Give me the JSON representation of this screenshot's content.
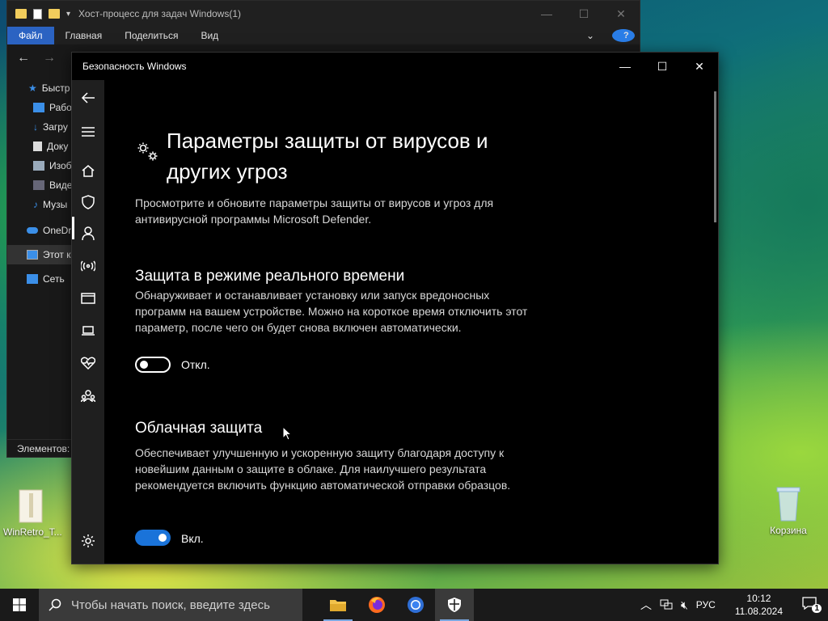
{
  "explorer": {
    "title": "Хост-процесс для задач Windows(1)",
    "ribbon": [
      "Файл",
      "Главная",
      "Поделиться",
      "Вид"
    ],
    "help": "?",
    "tree": [
      {
        "label": "Быстр",
        "icon": "star-icon"
      },
      {
        "label": "Рабо",
        "icon": "desktop-folder-icon"
      },
      {
        "label": "Загру",
        "icon": "download-icon"
      },
      {
        "label": "Доку",
        "icon": "document-icon"
      },
      {
        "label": "Изоб",
        "icon": "pictures-icon"
      },
      {
        "label": "Виде",
        "icon": "video-icon"
      },
      {
        "label": "Музы",
        "icon": "music-icon"
      },
      {
        "label": "OneDr",
        "icon": "onedrive-icon"
      },
      {
        "label": "Этот к",
        "icon": "this-pc-icon"
      },
      {
        "label": "Сеть",
        "icon": "network-icon"
      }
    ],
    "status": "Элементов:"
  },
  "security": {
    "title": "Безопасность Windows",
    "heading": "Параметры защиты от вирусов и других угроз",
    "intro": "Просмотрите и обновите параметры защиты от вирусов и угроз для антивирусной программы Microsoft Defender.",
    "sections": [
      {
        "title": "Защита в режиме реального времени",
        "desc": "Обнаруживает и останавливает установку или запуск вредоносных программ на вашем устройстве. Можно на короткое время отключить этот параметр, после чего он будет снова включен автоматически.",
        "state": "Откл.",
        "on": false
      },
      {
        "title": "Облачная защита",
        "desc": "Обеспечивает улучшенную и ускоренную защиту благодаря доступу к новейшим данным о защите в облаке. Для наилучшего результата рекомендуется включить функцию автоматической отправки образцов.",
        "state": "Вкл.",
        "on": true
      }
    ],
    "rail": [
      "back-icon",
      "menu-icon",
      "home-icon",
      "shield-icon",
      "account-icon",
      "firewall-network-icon",
      "app-browser-icon",
      "device-security-icon",
      "health-heart-icon",
      "family-icon",
      "settings-gear-icon"
    ]
  },
  "desktop": {
    "icons": [
      {
        "label": "WinRetro_T...",
        "icon": "folder-zip-icon"
      },
      {
        "label": "Корзина",
        "icon": "recycle-bin-icon"
      }
    ]
  },
  "taskbar": {
    "search_placeholder": "Чтобы начать поиск, введите здесь",
    "apps": [
      "file-explorer-icon",
      "firefox-icon",
      "chrome-icon",
      "windows-security-icon"
    ],
    "lang": "РУС",
    "time": "10:12",
    "date": "11.08.2024",
    "notifications": "1"
  },
  "colors": {
    "accent": "#1a73d9",
    "file_tab": "#2b63c2"
  }
}
